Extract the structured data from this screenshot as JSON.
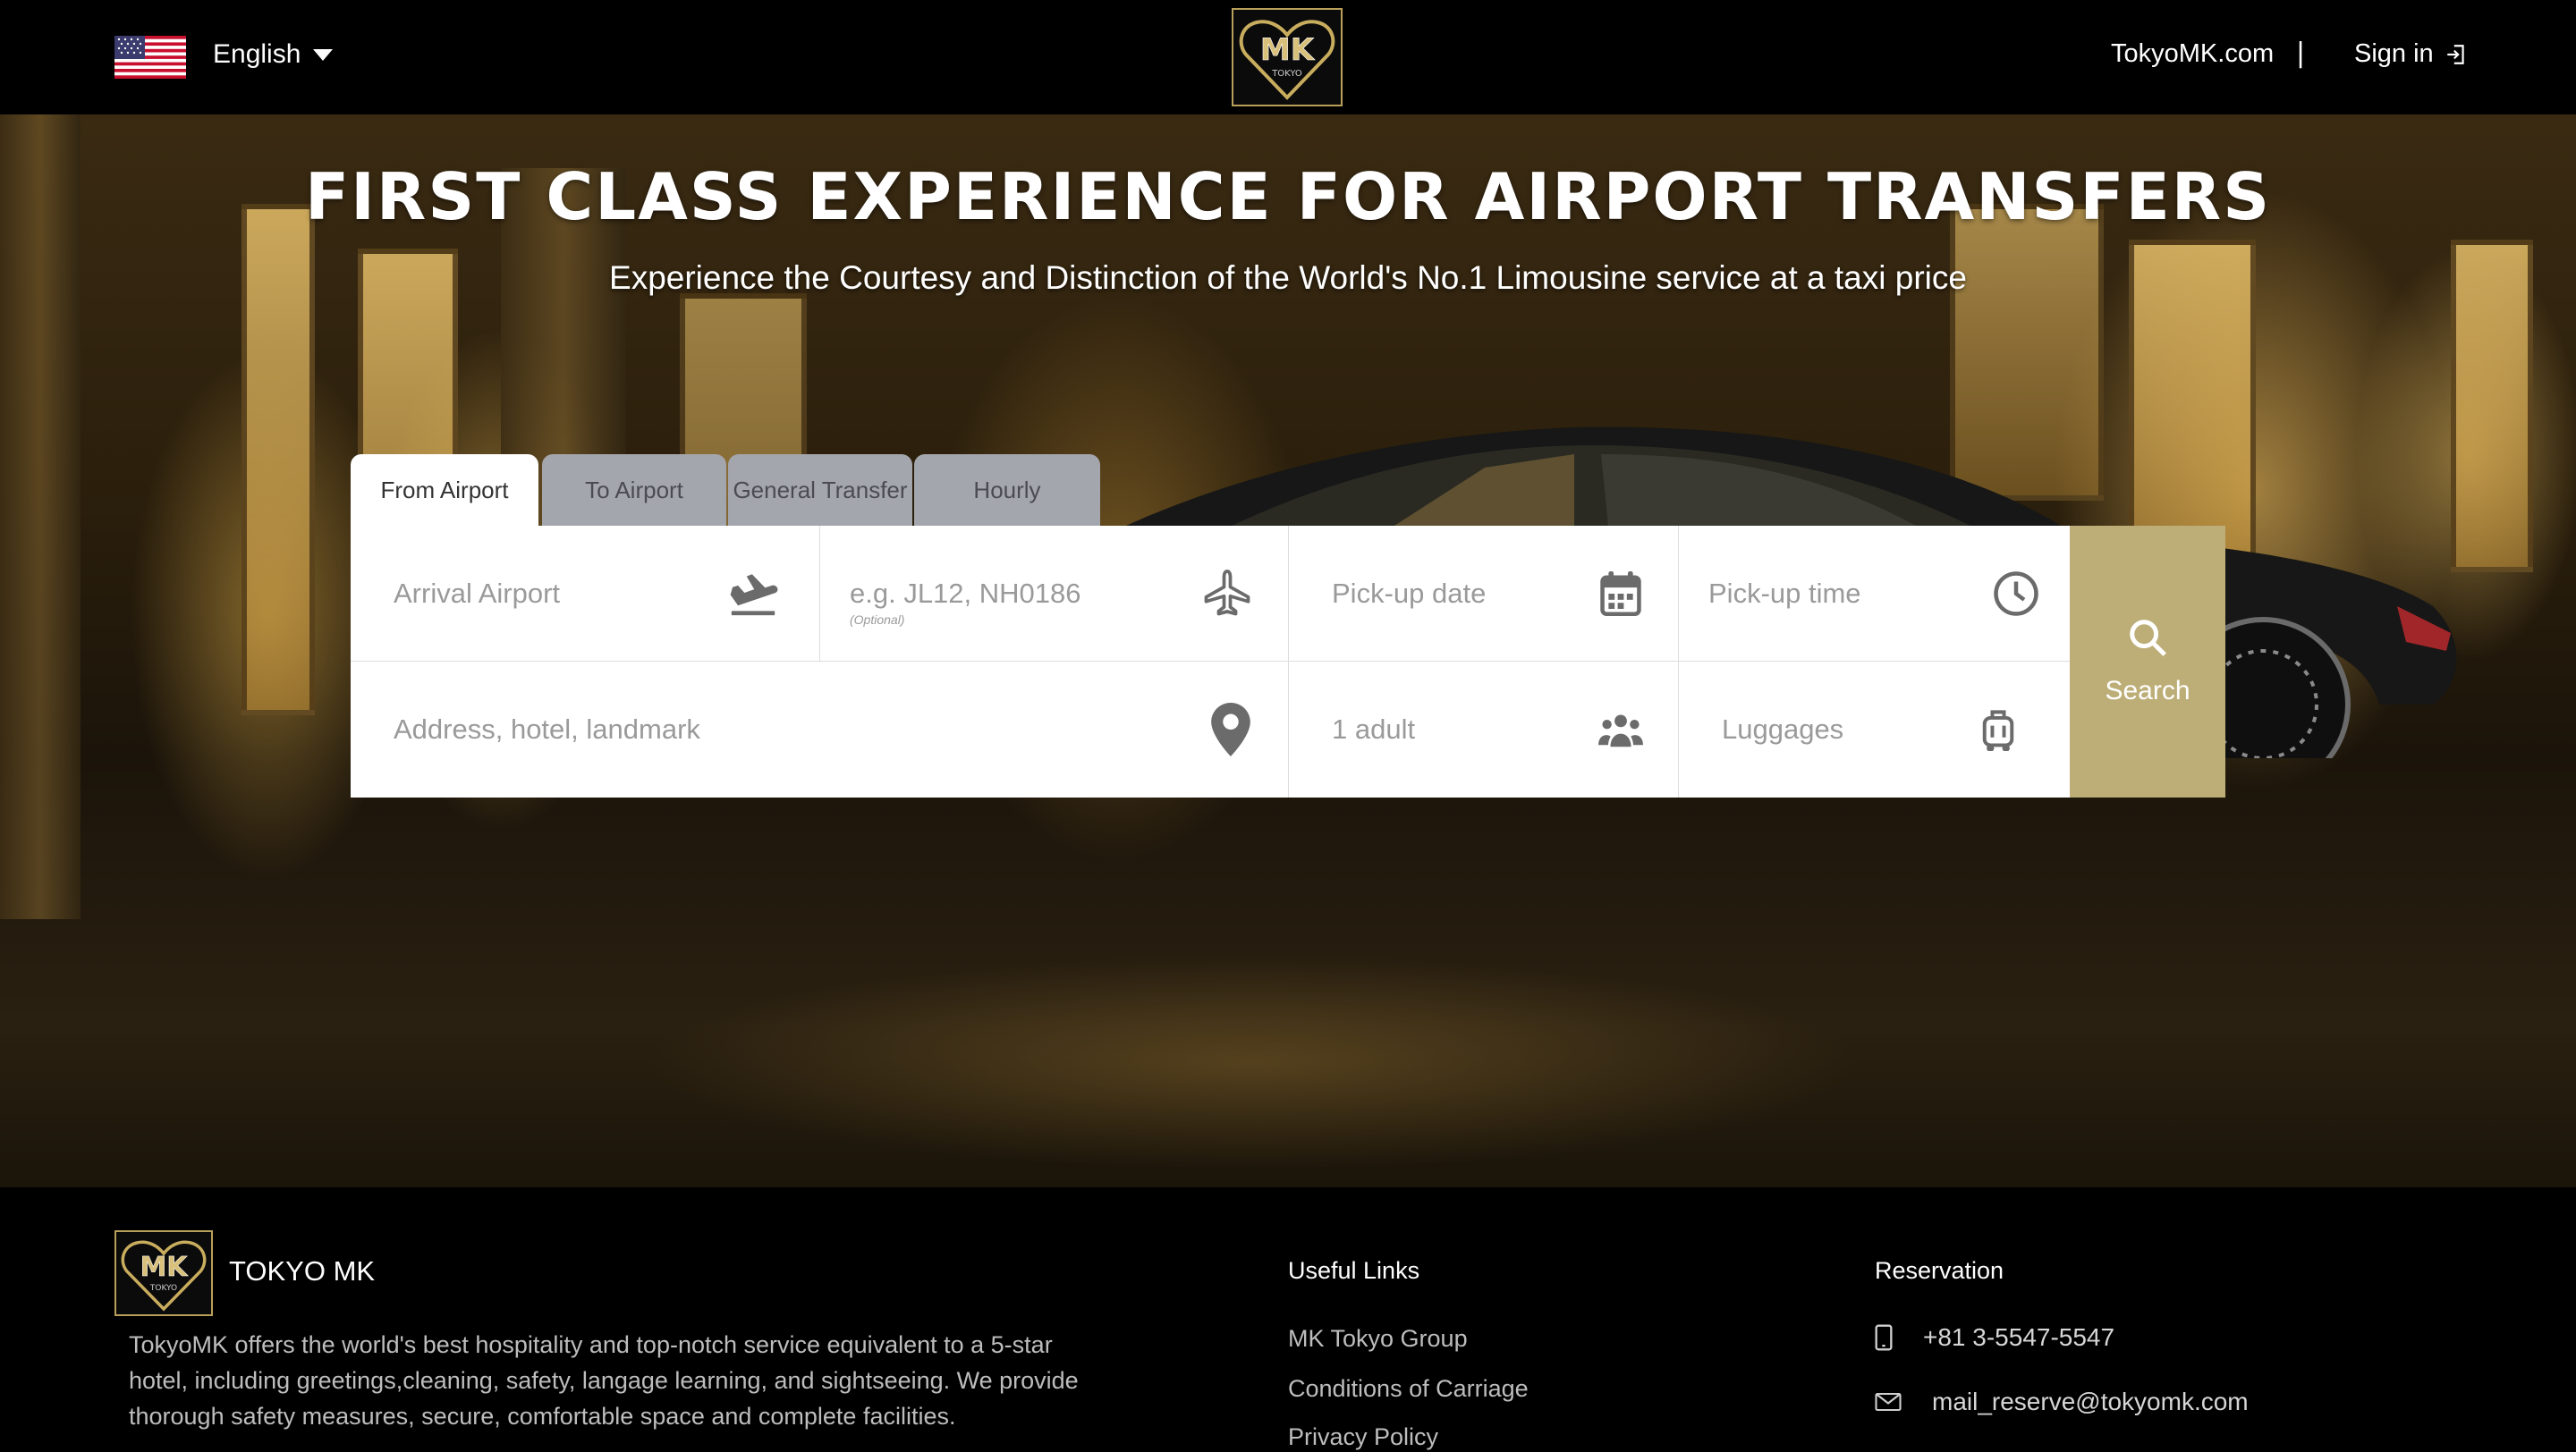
{
  "header": {
    "language": "English",
    "site_link": "TokyoMK.com",
    "separator": "|",
    "sign_in": "Sign in",
    "logo_text": "MK",
    "logo_sub": "TOKYO"
  },
  "hero": {
    "title": "FIRST CLASS EXPERIENCE FOR AIRPORT TRANSFERS",
    "subtitle": "Experience the Courtesy and Distinction of the World's No.1 Limousine service at a taxi price"
  },
  "booking": {
    "tabs": [
      {
        "label": "From Airport",
        "active": true
      },
      {
        "label": "To Airport",
        "active": false
      },
      {
        "label": "General Transfer",
        "active": false
      },
      {
        "label": "Hourly",
        "active": false
      }
    ],
    "fields": {
      "arrival_airport": "Arrival Airport",
      "flight_number": "e.g. JL12, NH0186",
      "flight_optional": "(Optional)",
      "pickup_date": "Pick-up date",
      "pickup_time": "Pick-up time",
      "address": "Address, hotel, landmark",
      "passengers": "1 adult",
      "luggages": "Luggages"
    },
    "search_label": "Search"
  },
  "footer": {
    "brand": "TOKYO MK",
    "description": "TokyoMK offers the world's best hospitality and top-notch service equivalent to a 5-star hotel, including greetings,cleaning, safety, langage learning, and sightseeing. We provide thorough safety measures, secure, comfortable space and complete facilities.",
    "useful_links_heading": "Useful Links",
    "useful_links": [
      "MK Tokyo Group",
      "Conditions of Carriage",
      "Privacy Policy"
    ],
    "reservation_heading": "Reservation",
    "phone": "+81 3-5547-5547",
    "email": "mail_reserve@tokyomk.com"
  },
  "colors": {
    "accent_gold": "#bdae78",
    "tab_inactive": "#a4a6ad",
    "header_bg": "#000000"
  }
}
